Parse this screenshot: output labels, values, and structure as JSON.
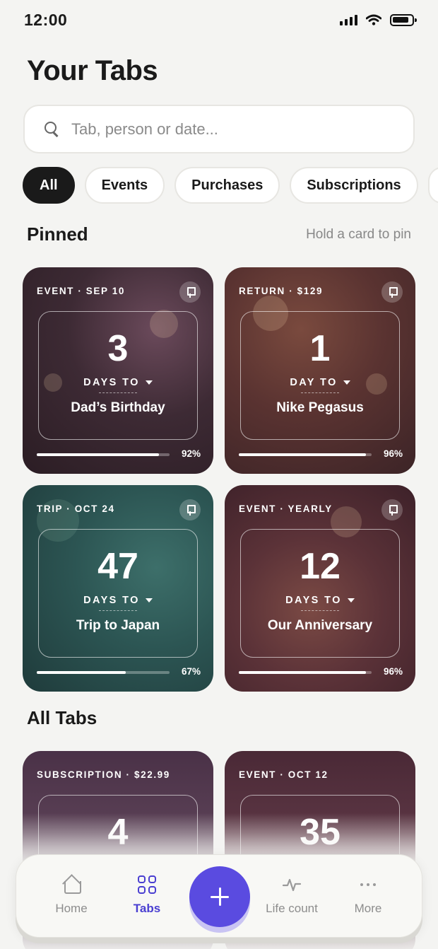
{
  "status_bar": {
    "time": "12:00"
  },
  "header": {
    "title": "Your Tabs"
  },
  "search": {
    "placeholder": "Tab, person or date..."
  },
  "filters": [
    "All",
    "Events",
    "Purchases",
    "Subscriptions"
  ],
  "pinned": {
    "title": "Pinned",
    "hint": "Hold a card to pin",
    "cards": [
      {
        "meta": "EVENT · SEP 10",
        "count": "3",
        "unit": "DAYS TO",
        "name": "Dad’s Birthday",
        "progress_label": "92%",
        "progress": 0.92
      },
      {
        "meta": "RETURN · $129",
        "count": "1",
        "unit": "DAY TO",
        "name": "Nike Pegasus",
        "progress_label": "96%",
        "progress": 0.96
      },
      {
        "meta": "TRIP · OCT 24",
        "count": "47",
        "unit": "DAYS TO",
        "name": "Trip to Japan",
        "progress_label": "67%",
        "progress": 0.67
      },
      {
        "meta": "EVENT · YEARLY",
        "count": "12",
        "unit": "DAYS TO",
        "name": "Our Anniversary",
        "progress_label": "96%",
        "progress": 0.96
      }
    ]
  },
  "all_tabs": {
    "title": "All Tabs",
    "cards": [
      {
        "meta": "SUBSCRIPTION · $22.99",
        "count": "4"
      },
      {
        "meta": "EVENT · OCT 12",
        "count": "35"
      }
    ]
  },
  "tab_bar": {
    "items": [
      "Home",
      "Tabs",
      "Life count",
      "More"
    ],
    "active": "Tabs",
    "accent": "#5a4be0"
  }
}
